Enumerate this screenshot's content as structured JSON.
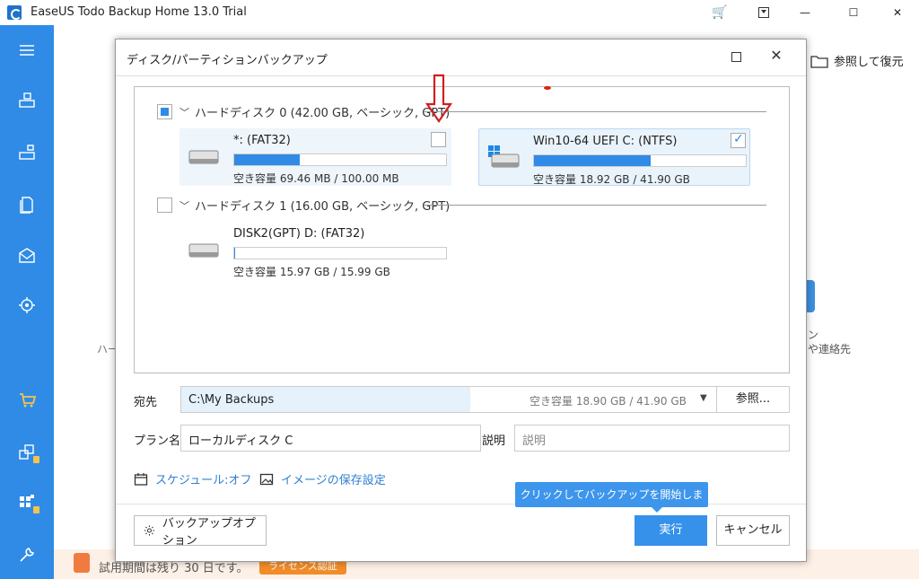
{
  "app": {
    "title": "EaseUS Todo Backup Home 13.0 Trial",
    "browse_restore": "参照して復元",
    "bg_left_text": "ハー",
    "bg_right_text": "ン",
    "bg_right_text2": "や連絡先",
    "trial_text": "試用期間は残り 30 日です。",
    "license_label": "ライセンス認証"
  },
  "window_controls": {
    "minimize": "—",
    "maximize": "☐",
    "close": "✕"
  },
  "sidebar": {
    "items": [
      "menu-icon",
      "disk-backup-icon",
      "partition-backup-icon",
      "file-backup-icon",
      "mail-backup-icon",
      "smart-backup-icon",
      "cart-icon",
      "clone-icon",
      "system-transfer-icon",
      "tools-icon"
    ]
  },
  "dialog": {
    "title": "ディスク/パーティションバックアップ",
    "close": "✕",
    "disks": [
      {
        "label": "ハードディスク 0 (42.00 GB, ベーシック, GPT)",
        "state": "partial",
        "partitions": [
          {
            "name": "*: (FAT32)",
            "free": "空き容量 69.46 MB / 100.00 MB",
            "used_fraction": 0.31,
            "checked": false
          },
          {
            "name": "Win10-64  UEFI C: (NTFS)",
            "free": "空き容量 18.92 GB / 41.90 GB",
            "used_fraction": 0.55,
            "checked": true
          }
        ]
      },
      {
        "label": "ハードディスク 1 (16.00 GB, ベーシック, GPT)",
        "state": "unchecked",
        "partitions": [
          {
            "name": "DISK2(GPT) D: (FAT32)",
            "free": "空き容量 15.97 GB / 15.99 GB",
            "used_fraction": 0.0,
            "checked": false
          }
        ]
      }
    ],
    "destination": {
      "label": "宛先",
      "path": "C:\\My Backups",
      "free": "空き容量 18.90 GB / 41.90 GB",
      "browse": "参照..."
    },
    "plan": {
      "label": "プラン名",
      "value": "ローカルディスク C"
    },
    "description": {
      "label": "説明",
      "placeholder": "説明"
    },
    "schedule_link": "スケジュール:オフ",
    "image_settings_link": "イメージの保存設定",
    "tooltip": "クリックしてバックアップを開始します。",
    "options_button": "バックアップオプション",
    "run_button": "実行",
    "cancel_button": "キャンセル"
  },
  "colors": {
    "sidebar": "#2f8be6",
    "accent": "#3591ea",
    "annotation": "#d21f1f"
  }
}
